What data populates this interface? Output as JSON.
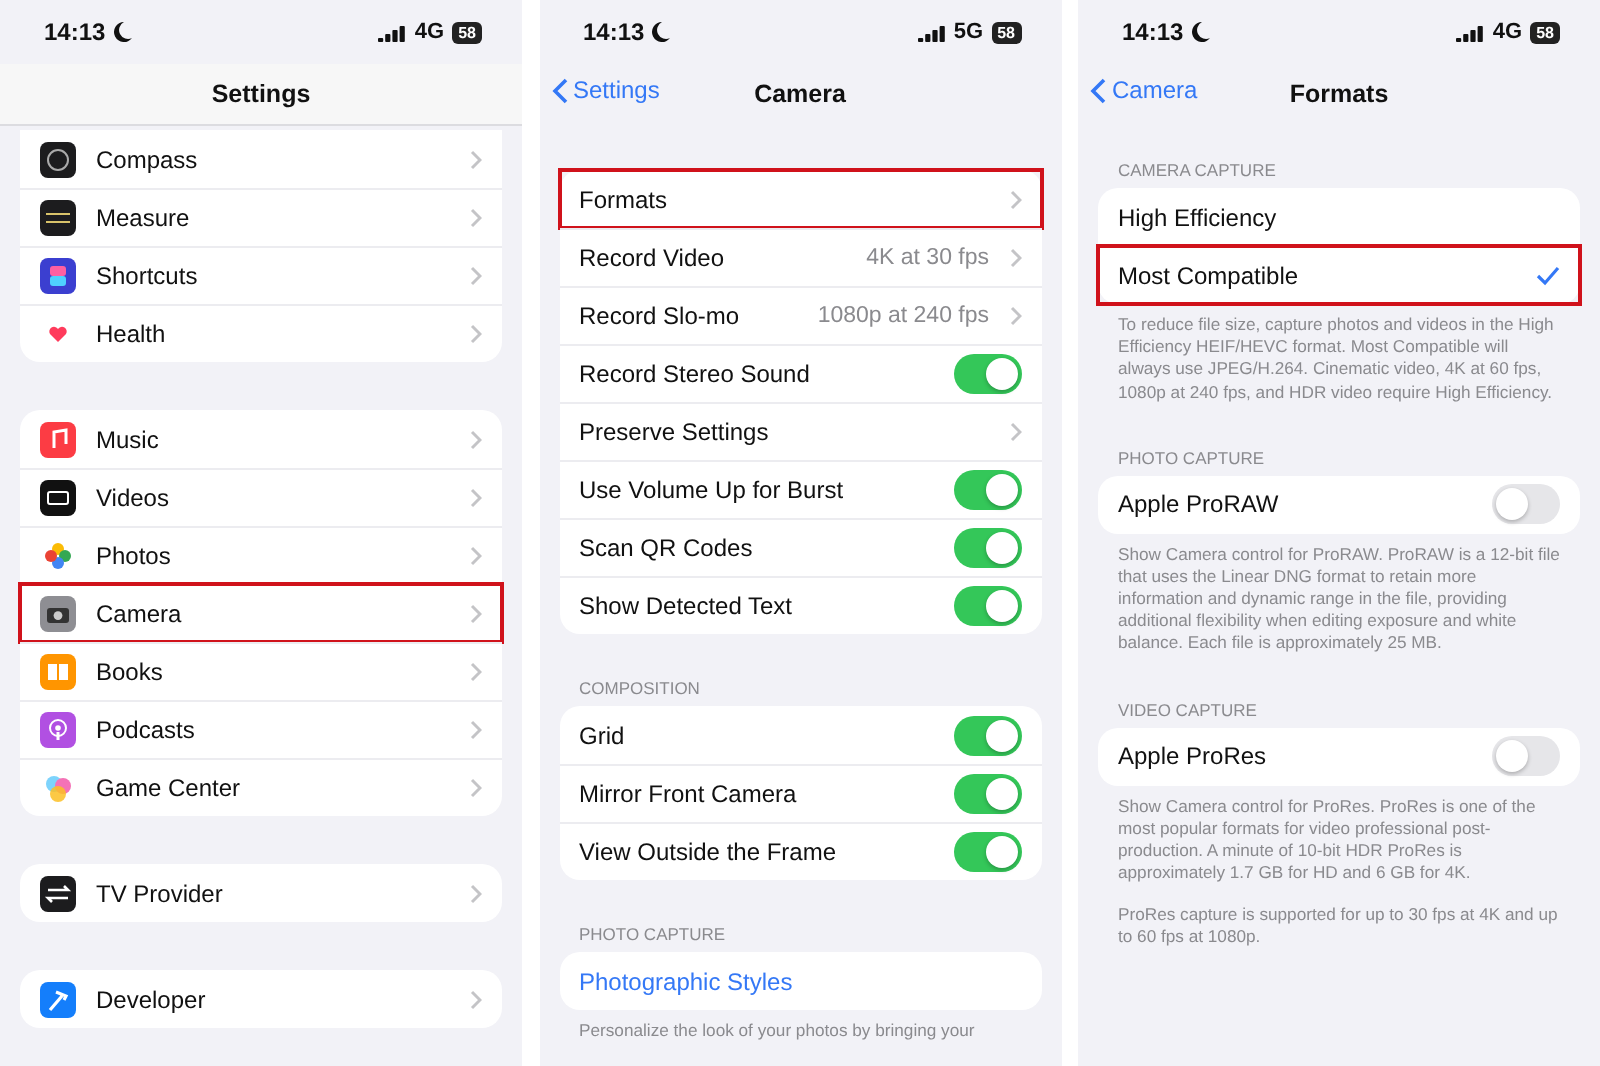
{
  "screens": [
    {
      "status": {
        "time": "14:13",
        "network": "4G",
        "battery": "58"
      },
      "nav": {
        "title": "Settings"
      },
      "sections": [
        {
          "rows": [
            {
              "kind": "link",
              "label": "Compass",
              "highlighted": false
            },
            {
              "kind": "link",
              "label": "Measure",
              "highlighted": false
            },
            {
              "kind": "link",
              "label": "Shortcuts",
              "highlighted": false
            },
            {
              "kind": "link",
              "label": "Health",
              "highlighted": false
            }
          ]
        },
        {
          "rows": [
            {
              "kind": "link",
              "label": "Music",
              "highlighted": false
            },
            {
              "kind": "link",
              "label": "Videos",
              "highlighted": false
            },
            {
              "kind": "link",
              "label": "Photos",
              "highlighted": false
            },
            {
              "kind": "link",
              "label": "Camera",
              "highlighted": true
            },
            {
              "kind": "link",
              "label": "Books",
              "highlighted": false
            },
            {
              "kind": "link",
              "label": "Podcasts",
              "highlighted": false
            },
            {
              "kind": "link",
              "label": "Game Center",
              "highlighted": false
            }
          ]
        },
        {
          "rows": [
            {
              "kind": "link",
              "label": "TV Provider",
              "highlighted": false
            }
          ]
        },
        {
          "rows": [
            {
              "kind": "link",
              "label": "Developer",
              "highlighted": false
            }
          ]
        }
      ]
    },
    {
      "status": {
        "time": "14:13",
        "network": "5G",
        "battery": "58"
      },
      "nav": {
        "back": "Settings",
        "title": "Camera"
      },
      "sections": [
        {
          "rows": [
            {
              "kind": "link",
              "label": "Formats",
              "highlighted": true
            },
            {
              "kind": "link",
              "label": "Record Video",
              "value": "4K at 30 fps",
              "highlighted": false
            },
            {
              "kind": "link",
              "label": "Record Slo-mo",
              "value": "1080p at 240 fps",
              "highlighted": false
            },
            {
              "kind": "toggle",
              "label": "Record Stereo Sound",
              "on": true
            },
            {
              "kind": "link",
              "label": "Preserve Settings",
              "highlighted": false
            },
            {
              "kind": "toggle",
              "label": "Use Volume Up for Burst",
              "on": true
            },
            {
              "kind": "toggle",
              "label": "Scan QR Codes",
              "on": true
            },
            {
              "kind": "toggle",
              "label": "Show Detected Text",
              "on": true
            }
          ]
        },
        {
          "header": "COMPOSITION",
          "rows": [
            {
              "kind": "toggle",
              "label": "Grid",
              "on": true
            },
            {
              "kind": "toggle",
              "label": "Mirror Front Camera",
              "on": true
            },
            {
              "kind": "toggle",
              "label": "View Outside the Frame",
              "on": true
            }
          ]
        },
        {
          "header": "PHOTO CAPTURE",
          "rows": [
            {
              "kind": "action",
              "label": "Photographic Styles"
            }
          ],
          "footers": [
            "Personalize the look of your photos by bringing your"
          ]
        }
      ]
    },
    {
      "status": {
        "time": "14:13",
        "network": "4G",
        "battery": "58"
      },
      "nav": {
        "back": "Camera",
        "title": "Formats"
      },
      "sections": [
        {
          "header": "CAMERA CAPTURE",
          "rows": [
            {
              "kind": "check",
              "label": "High Efficiency",
              "selected": false,
              "highlighted": false
            },
            {
              "kind": "check",
              "label": "Most Compatible",
              "selected": true,
              "highlighted": true
            }
          ],
          "footers": [
            "To reduce file size, capture photos and videos in the High Efficiency HEIF/HEVC format. Most Compatible will always use JPEG/H.264. Cinematic video, 4K at 60 fps, 1080p at 240 fps, and HDR video require High Efficiency."
          ]
        },
        {
          "header": "PHOTO CAPTURE",
          "rows": [
            {
              "kind": "toggle",
              "label": "Apple ProRAW",
              "on": false
            }
          ],
          "footers": [
            "Show Camera control for ProRAW. ProRAW is a 12-bit file that uses the Linear DNG format to retain more information and dynamic range in the file, providing additional flexibility when editing exposure and white balance. Each file is approximately 25 MB."
          ]
        },
        {
          "header": "VIDEO CAPTURE",
          "rows": [
            {
              "kind": "toggle",
              "label": "Apple ProRes",
              "on": false
            }
          ],
          "footers": [
            "Show Camera control for ProRes. ProRes is one of the most popular formats for video professional post-production. A minute of 10-bit HDR ProRes is approximately 1.7 GB for HD and 6 GB for 4K.",
            "ProRes capture is supported for up to 30 fps at 4K and up to 60 fps at 1080p."
          ]
        }
      ]
    }
  ]
}
